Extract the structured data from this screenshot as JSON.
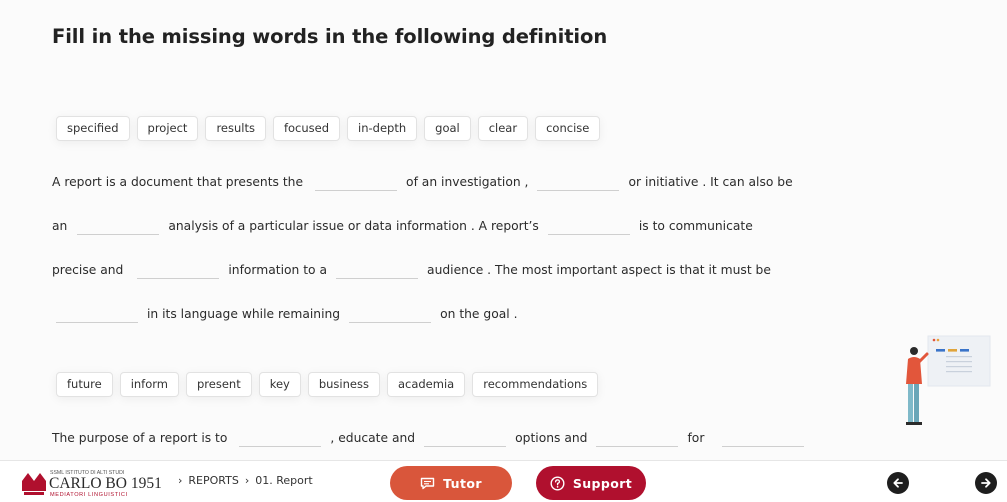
{
  "title": "Fill in the missing words in the following definition",
  "bank1": [
    "specified",
    "project",
    "results",
    "focused",
    "in-depth",
    "goal",
    "clear",
    "concise"
  ],
  "bank2": [
    "future",
    "inform",
    "present",
    "key",
    "business",
    "academia",
    "recommendations"
  ],
  "text": {
    "l1a": "A report is a document that presents the",
    "l1b": "of an investigation ,",
    "l1c": "or initiative . It can also be",
    "l2a": "an",
    "l2b": "analysis of a particular issue or data information . A report’s",
    "l2c": "is to communicate",
    "l3a": "precise and",
    "l3b": "information to a",
    "l3c": "audience . The most important aspect is that it must be",
    "l4a": "in its language while remaining",
    "l4b": "on the goal .",
    "l5a": "The purpose of a report is to",
    "l5b": ", educate and",
    "l5c": "options and",
    "l5d": "for"
  },
  "footer": {
    "logo_top": "SSML ISTITUTO DI ALTI STUDI",
    "logo_main": "CARLO BO 1951",
    "logo_sub": "MEDIATORI LINGUISTICI",
    "breadcrumb": [
      "REPORTS",
      "01. Report"
    ],
    "separator": "›",
    "tutor_label": "Tutor",
    "support_label": "Support"
  },
  "colors": {
    "tutor": "#d9563b",
    "support": "#b0102e",
    "logo_red": "#b0102e"
  },
  "icons": [
    "chat-icon",
    "question-circle-icon",
    "arrow-left-icon",
    "arrow-right-icon"
  ]
}
